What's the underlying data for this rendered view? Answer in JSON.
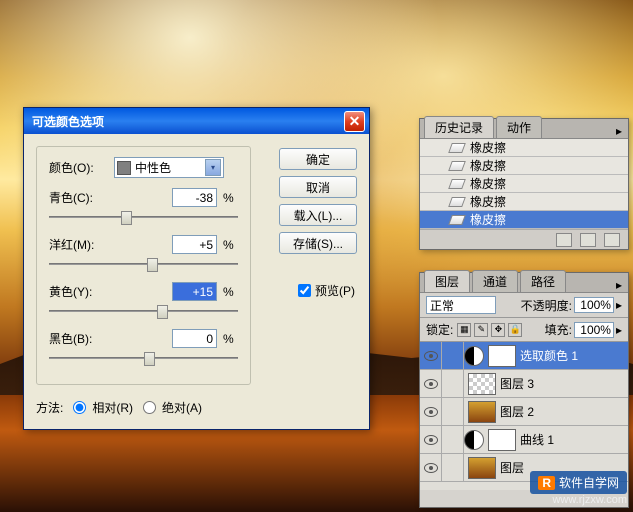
{
  "dialog": {
    "title": "可选颜色选项",
    "color_label": "颜色(O):",
    "color_value": "中性色",
    "sliders": [
      {
        "label": "青色(C):",
        "value": "-38",
        "pos": 38
      },
      {
        "label": "洋红(M):",
        "value": "+5",
        "pos": 52
      },
      {
        "label": "黄色(Y):",
        "value": "+15",
        "pos": 57,
        "hl": true
      },
      {
        "label": "黑色(B):",
        "value": "0",
        "pos": 50
      }
    ],
    "pct": "%",
    "method_label": "方法:",
    "method_rel": "相对(R)",
    "method_abs": "绝对(A)",
    "buttons": {
      "ok": "确定",
      "cancel": "取消",
      "load": "载入(L)...",
      "save": "存储(S)..."
    },
    "preview": "预览(P)"
  },
  "history": {
    "tab1": "历史记录",
    "tab2": "动作",
    "items": [
      "橡皮擦",
      "橡皮擦",
      "橡皮擦",
      "橡皮擦",
      "橡皮擦"
    ]
  },
  "layers": {
    "tab1": "图层",
    "tab2": "通道",
    "tab3": "路径",
    "mode": "正常",
    "opacity_label": "不透明度:",
    "opacity": "100%",
    "lock_label": "锁定:",
    "fill_label": "填充:",
    "fill": "100%",
    "items": [
      {
        "name": "选取颜色 1",
        "type": "adj",
        "sel": true
      },
      {
        "name": "图层 3",
        "type": "checker"
      },
      {
        "name": "图层 2",
        "type": "img"
      },
      {
        "name": "曲线 1",
        "type": "adj"
      },
      {
        "name": "图层",
        "type": "img"
      }
    ]
  },
  "watermark": {
    "brand": "软件自学网",
    "url": "www.rjzxw.com"
  }
}
